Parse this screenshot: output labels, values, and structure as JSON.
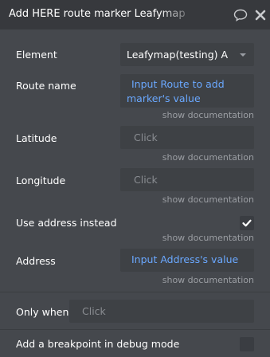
{
  "header": {
    "title": "Add HERE route marker Leafymap",
    "comment_icon": "comment-bubble-icon",
    "close_icon": "close-icon"
  },
  "fields": {
    "element": {
      "label": "Element",
      "value": "Leafymap(testing) A"
    },
    "route_name": {
      "label": "Route name",
      "value_line1": "Input Route to add",
      "value_line2": "marker's value",
      "doc": "show documentation"
    },
    "latitude": {
      "label": "Latitude",
      "placeholder": "Click",
      "doc": "show documentation"
    },
    "longitude": {
      "label": "Longitude",
      "placeholder": "Click",
      "doc": "show documentation"
    },
    "use_address": {
      "label": "Use address instead",
      "checked": true,
      "doc": "show documentation"
    },
    "address": {
      "label": "Address",
      "value": "Input Address's value",
      "doc": "show documentation"
    }
  },
  "footer": {
    "only_when": {
      "label": "Only when",
      "placeholder": "Click"
    },
    "breakpoint": {
      "label": "Add a breakpoint in debug mode",
      "checked": false
    }
  },
  "colors": {
    "panel": "#45484d",
    "titlebar": "#37393d",
    "input": "#3e4145",
    "expression": "#6aa8ff",
    "muted": "#9b9ea3"
  }
}
